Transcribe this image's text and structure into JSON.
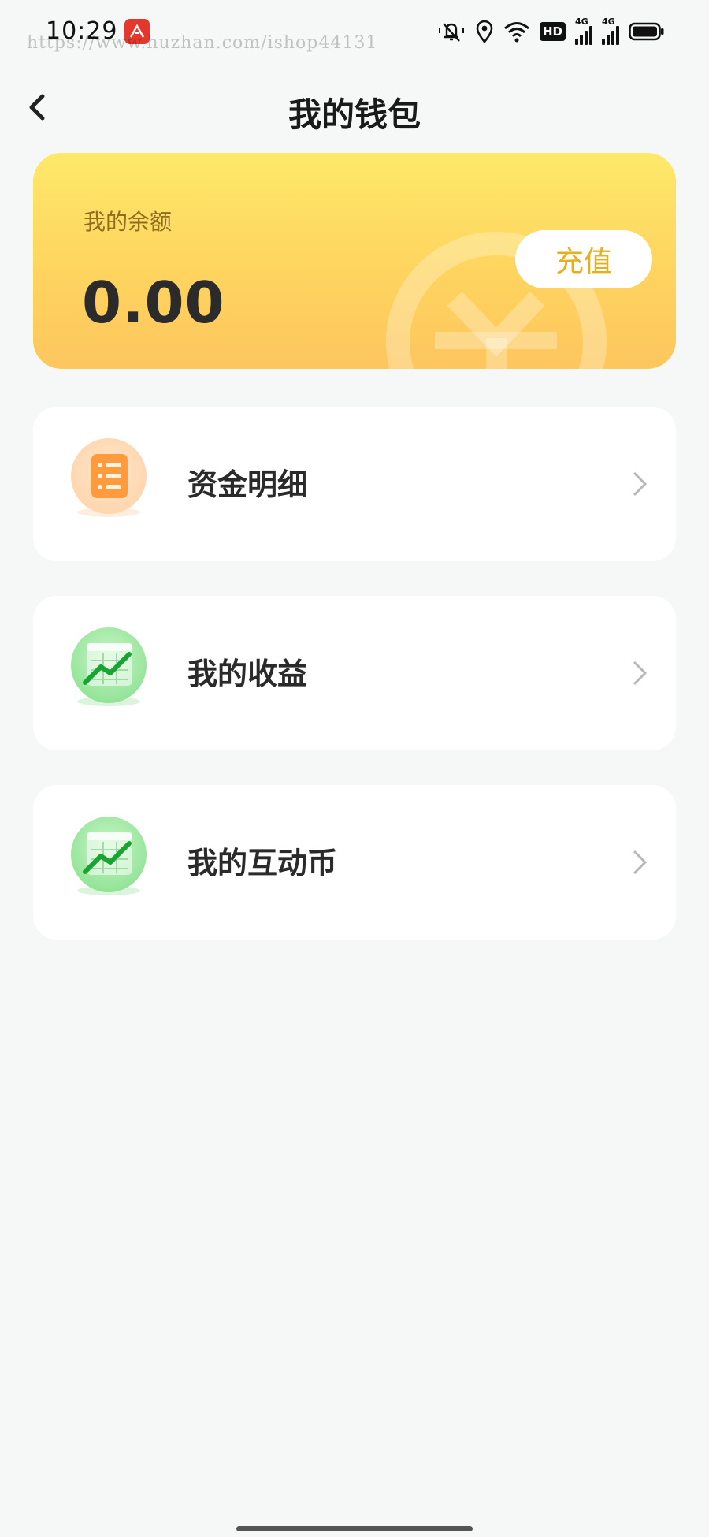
{
  "status_bar": {
    "time": "10:29",
    "watermark": "https://www.huzhan.com/ishop44131",
    "hd_label": "HD",
    "network_1": "4G",
    "network_2": "4G",
    "icons": [
      "notification-app-icon",
      "mute-bell-icon",
      "location-icon",
      "wifi-icon",
      "hd-icon",
      "signal-icon",
      "signal-icon",
      "battery-icon"
    ]
  },
  "header": {
    "title": "我的钱包",
    "back_icon": "chevron-left-icon"
  },
  "balance": {
    "label": "我的余额",
    "amount": "0.00",
    "recharge_label": "充值",
    "deco_icon": "yuan-coin-icon"
  },
  "menu": [
    {
      "label": "资金明细",
      "icon": "list-document-icon",
      "icon_color": "#ff8a2a"
    },
    {
      "label": "我的收益",
      "icon": "growth-chart-icon",
      "icon_color": "#1fb33a"
    },
    {
      "label": "我的互动币",
      "icon": "growth-chart-icon",
      "icon_color": "#1fb33a"
    }
  ],
  "colors": {
    "card_gradient_top": "#fde96a",
    "card_gradient_bottom": "#fdc65e",
    "recharge_text": "#e5b020",
    "background": "#f6f8f8"
  }
}
